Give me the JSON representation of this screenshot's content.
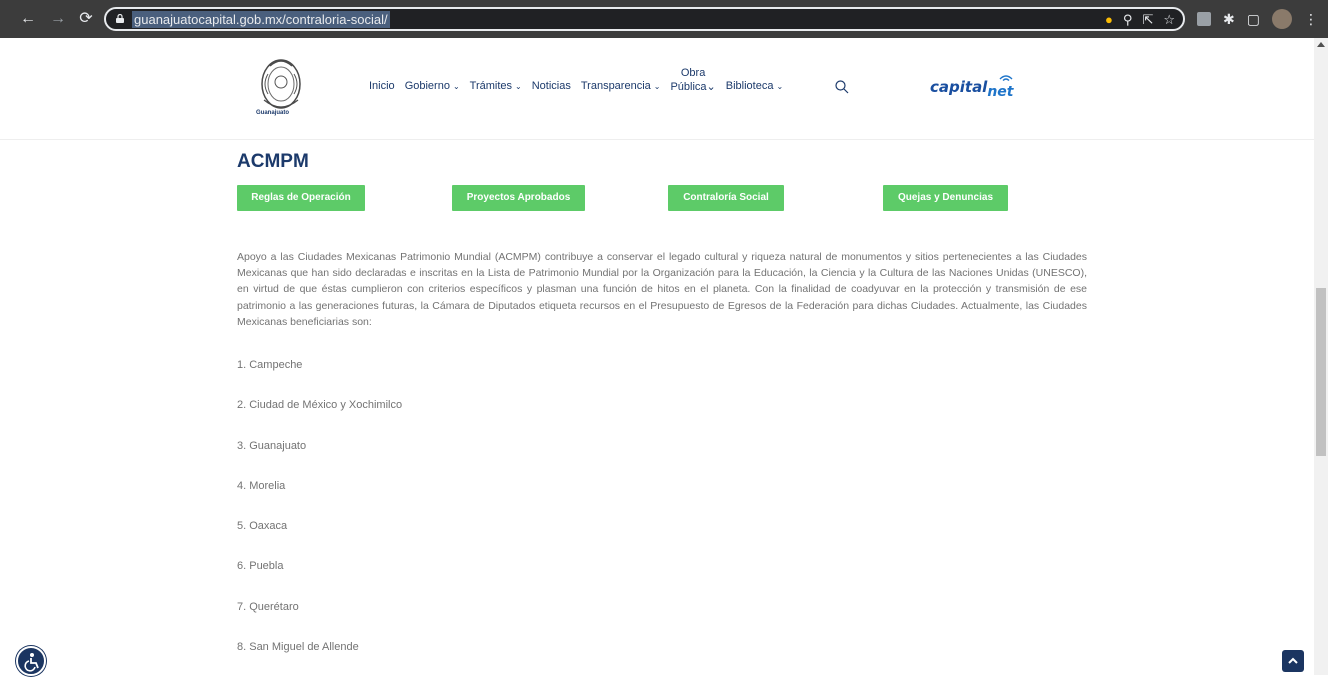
{
  "browser": {
    "url": "guanajuatocapital.gob.mx/contraloria-social/"
  },
  "header": {
    "logo_text": "Guanajuato",
    "nav": [
      {
        "label": "Inicio",
        "has_dropdown": false
      },
      {
        "label": "Gobierno",
        "has_dropdown": true
      },
      {
        "label": "Trámites",
        "has_dropdown": true
      },
      {
        "label": "Noticias",
        "has_dropdown": false
      },
      {
        "label": "Transparencia",
        "has_dropdown": true
      },
      {
        "label_line1": "Obra",
        "label_line2": "Pública",
        "has_dropdown": true
      },
      {
        "label": "Biblioteca",
        "has_dropdown": true
      }
    ],
    "capitalnet_logo": {
      "part1": "capital",
      "part2": "net"
    }
  },
  "main": {
    "title": "ACMPM",
    "buttons": [
      {
        "label": "Reglas de Operación"
      },
      {
        "label": "Proyectos Aprobados"
      },
      {
        "label": "Contraloría Social"
      },
      {
        "label": "Quejas y Denuncias"
      }
    ],
    "intro": "Apoyo a las Ciudades Mexicanas Patrimonio Mundial (ACMPM) contribuye a conservar el legado cultural y riqueza natural de monumentos y sitios pertenecientes a las Ciudades Mexicanas que han sido declaradas e inscritas en la Lista de Patrimonio Mundial por la Organización para la Educación, la Ciencia y la Cultura de las Naciones Unidas (UNESCO), en virtud de que éstas cumplieron con criterios específicos y plasman una función de hitos en el planeta. Con la finalidad de coadyuvar en la protección y transmisión de ese patrimonio a las generaciones futuras, la Cámara de Diputados etiqueta recursos en el Presupuesto de Egresos de la Federación para dichas Ciudades. Actualmente, las Ciudades Mexicanas beneficiarias son:",
    "cities": [
      "1. Campeche",
      "2. Ciudad de México y Xochimilco",
      "3. Guanajuato",
      "4. Morelia",
      "5. Oaxaca",
      "6. Puebla",
      "7. Querétaro",
      "8. San Miguel de Allende"
    ]
  },
  "colors": {
    "title_blue": "#1c3a6b",
    "button_green": "#5dcb68",
    "body_text": "#737373",
    "browser_chrome": "#3c3c3c"
  }
}
